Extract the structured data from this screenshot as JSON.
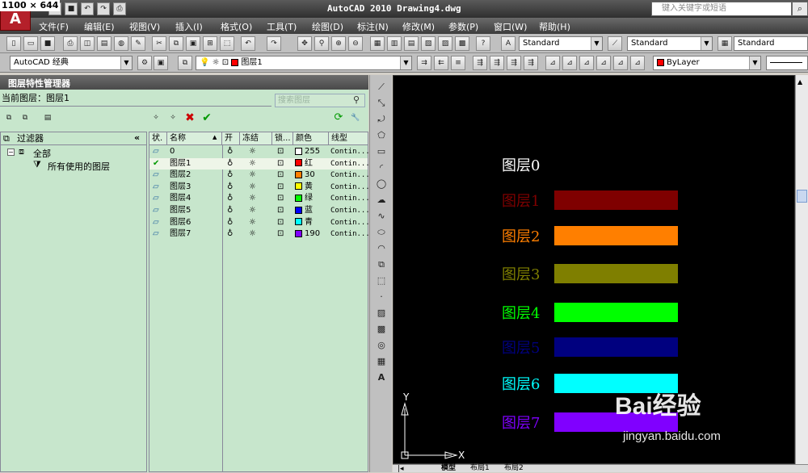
{
  "dims": "1100 × 644",
  "app": {
    "title": "AutoCAD 2010  Drawing4.dwg",
    "logo": "A",
    "search_placeholder": "键入关键字或短语"
  },
  "menu": [
    "文件(F)",
    "编辑(E)",
    "视图(V)",
    "插入(I)",
    "格式(O)",
    "工具(T)",
    "绘图(D)",
    "标注(N)",
    "修改(M)",
    "参数(P)",
    "窗口(W)",
    "帮助(H)"
  ],
  "toolbar1": {
    "text_style": "Standard",
    "dim_style": "Standard",
    "table_style": "Standard"
  },
  "toolbar2": {
    "workspace": "AutoCAD 经典",
    "layer_combo": "图层1",
    "color_combo": "ByLayer"
  },
  "panel": {
    "title": "图层特性管理器",
    "current_layer_label": "当前图层：",
    "current_layer": "图层1",
    "search_placeholder": "搜索图层",
    "filter_header": "过滤器",
    "tree_all": "全部",
    "tree_used": "所有使用的图层",
    "columns": [
      "状.",
      "名称",
      "开",
      "冻结",
      "锁...",
      "颜色",
      "线型"
    ],
    "layers": [
      {
        "name": "0",
        "color_name": "255",
        "color": "#ffffff",
        "linetype": "Contin..."
      },
      {
        "name": "图层1",
        "color_name": "红",
        "color": "#ff0000",
        "linetype": "Contin...",
        "current": true
      },
      {
        "name": "图层2",
        "color_name": "30",
        "color": "#ff7f00",
        "linetype": "Contin..."
      },
      {
        "name": "图层3",
        "color_name": "黄",
        "color": "#ffff00",
        "linetype": "Contin..."
      },
      {
        "name": "图层4",
        "color_name": "绿",
        "color": "#00ff00",
        "linetype": "Contin..."
      },
      {
        "name": "图层5",
        "color_name": "蓝",
        "color": "#0000ff",
        "linetype": "Contin..."
      },
      {
        "name": "图层6",
        "color_name": "青",
        "color": "#00ffff",
        "linetype": "Contin..."
      },
      {
        "name": "图层7",
        "color_name": "190",
        "color": "#8000ff",
        "linetype": "Contin..."
      }
    ]
  },
  "drawing": {
    "items": [
      {
        "label": "图层0",
        "text_color": "#ffffff",
        "bar_color": null
      },
      {
        "label": "图层1",
        "text_color": "#7f0000",
        "bar_color": "#7f0000"
      },
      {
        "label": "图层2",
        "text_color": "#ff7f00",
        "bar_color": "#ff7f00"
      },
      {
        "label": "图层3",
        "text_color": "#7f7f00",
        "bar_color": "#7f7f00"
      },
      {
        "label": "图层4",
        "text_color": "#00ff00",
        "bar_color": "#00ff00"
      },
      {
        "label": "图层5",
        "text_color": "#00007f",
        "bar_color": "#00007f"
      },
      {
        "label": "图层6",
        "text_color": "#00ffff",
        "bar_color": "#00ffff"
      },
      {
        "label": "图层7",
        "text_color": "#8000ff",
        "bar_color": "#8000ff"
      }
    ],
    "ucs_x": "X",
    "ucs_y": "Y"
  },
  "tabs": [
    "模型",
    "布局1",
    "布局2"
  ],
  "watermark": {
    "text": "Bai经验",
    "url": "jingyan.baidu.com"
  }
}
